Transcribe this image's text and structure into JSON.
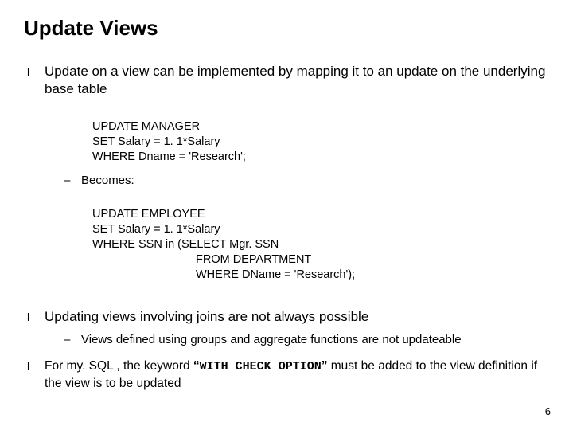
{
  "title": "Update Views",
  "bullet1": "Update on a view can be implemented by mapping it to an update on the underlying base table",
  "code1_l1": "UPDATE MANAGER",
  "code1_l2": "SET Salary = 1. 1*Salary",
  "code1_l3": "WHERE Dname = 'Research';",
  "sub1": "Becomes:",
  "code2_l1": "UPDATE EMPLOYEE",
  "code2_l2": "SET Salary = 1. 1*Salary",
  "code2_l3": "WHERE SSN in (SELECT Mgr. SSN",
  "code2_l4": "FROM DEPARTMENT",
  "code2_l5": "WHERE DName = 'Research');",
  "bullet2": "Updating views involving joins are not always possible",
  "sub2": "Views defined using groups and aggregate functions are not updateable",
  "bullet3_a": "For my. SQL ,  the keyword ",
  "bullet3_q1": "“",
  "bullet3_code": "WITH CHECK OPTION",
  "bullet3_q2": "”",
  "bullet3_b": " must be added to the view definition if the view is to be updated",
  "pagenum": "6"
}
